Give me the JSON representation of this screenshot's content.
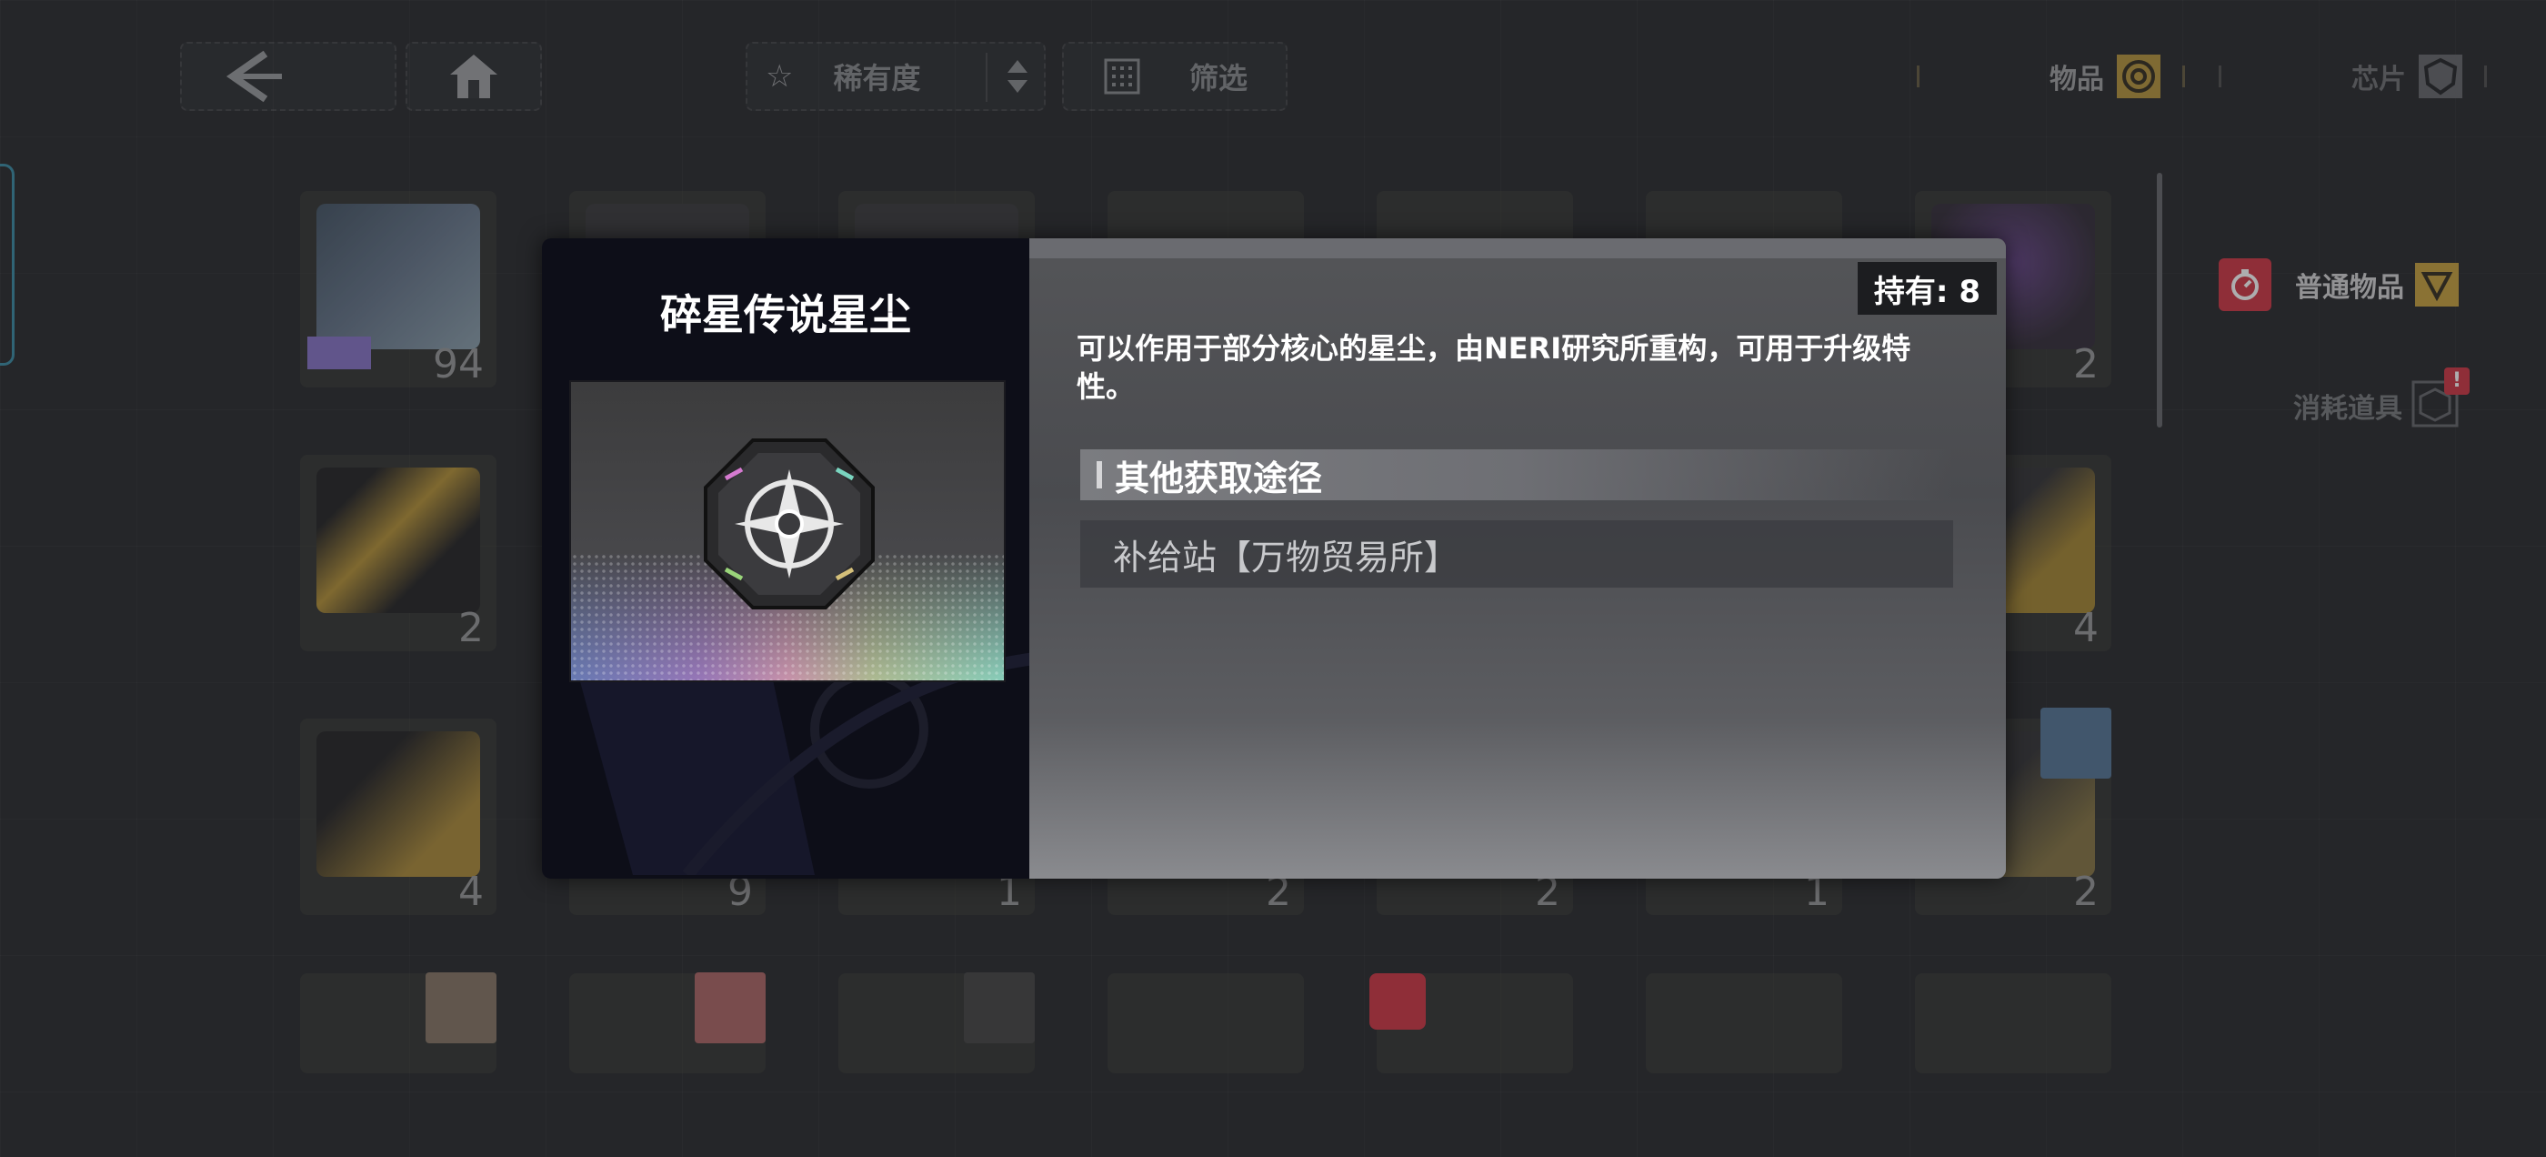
{
  "top_bar": {
    "sort_label": "稀有度",
    "filter_label": "筛选",
    "tab_items": "物品",
    "tab_chips": "芯片"
  },
  "categories": [
    {
      "label": "普通物品"
    },
    {
      "label": "消耗道具",
      "badge": "!"
    }
  ],
  "grid": {
    "row1": [
      "94",
      "",
      "",
      "",
      "",
      "",
      "2"
    ],
    "row2": [
      "2",
      "",
      "",
      "",
      "",
      "",
      "4"
    ],
    "row3": [
      "4",
      "9",
      "1",
      "2",
      "2",
      "1",
      "2"
    ]
  },
  "modal": {
    "item_name": "碎星传说星尘",
    "owned": "持有: 8",
    "description": "可以作用于部分核心的星尘，由NERI研究所重构，可用于升级特性。",
    "source_heading": "其他获取途径",
    "source_entries": [
      "补给站【万物贸易所】"
    ]
  },
  "colors": {
    "accent_gold": "#c9a544",
    "accent_red": "#d23c4a",
    "side_tab_cyan": "#3f8fa8"
  }
}
